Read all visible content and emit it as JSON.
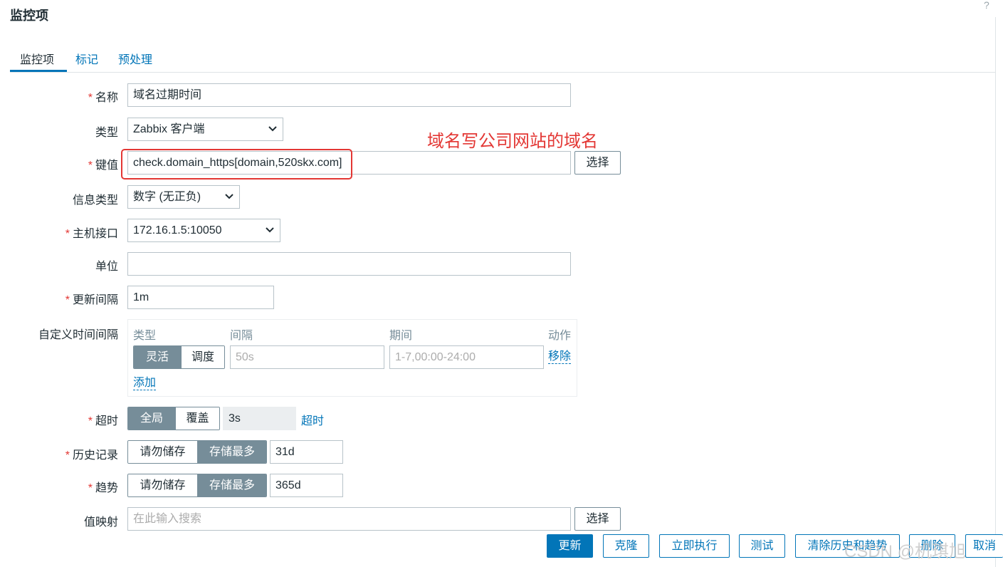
{
  "page": {
    "title": "监控项",
    "help": "?"
  },
  "tabs": [
    {
      "label": "监控项"
    },
    {
      "label": "标记"
    },
    {
      "label": "预处理"
    }
  ],
  "form": {
    "name": {
      "label": "名称",
      "value": "域名过期时间"
    },
    "type": {
      "label": "类型",
      "value": "Zabbix 客户端"
    },
    "key": {
      "label": "键值",
      "value": "check.domain_https[domain,520skx.com]",
      "select_label": "选择"
    },
    "value_type": {
      "label": "信息类型",
      "value": "数字 (无正负)"
    },
    "interface": {
      "label": "主机接口",
      "value": "172.16.1.5:10050"
    },
    "units": {
      "label": "单位",
      "value": ""
    },
    "delay": {
      "label": "更新间隔",
      "value": "1m"
    },
    "custom_intervals": {
      "label": "自定义时间间隔",
      "headers": {
        "type": "类型",
        "interval": "间隔",
        "period": "期间",
        "action": "动作"
      },
      "row": {
        "type_options": [
          "灵活",
          "调度"
        ],
        "interval_placeholder": "50s",
        "period_placeholder": "1-7,00:00-24:00",
        "remove_label": "移除"
      },
      "add_label": "添加"
    },
    "timeout": {
      "label": "超时",
      "options": [
        "全局",
        "覆盖"
      ],
      "value": "3s",
      "link": "超时"
    },
    "history": {
      "label": "历史记录",
      "options": [
        "请勿储存",
        "存储最多"
      ],
      "value": "31d"
    },
    "trends": {
      "label": "趋势",
      "options": [
        "请勿储存",
        "存储最多"
      ],
      "value": "365d"
    },
    "valuemap": {
      "label": "值映射",
      "placeholder": "在此输入搜索",
      "select_label": "选择"
    }
  },
  "annotation": {
    "text": "域名写公司网站的域名",
    "color": "#e33734"
  },
  "footer": {
    "buttons": [
      "更新",
      "克隆",
      "立即执行",
      "测试",
      "清除历史和趋势",
      "删除",
      "取消"
    ]
  },
  "watermark": "CSDN @机琪旭",
  "colors": {
    "accent": "#0275b8",
    "required": "#e33734",
    "segment_on": "#768d99"
  }
}
